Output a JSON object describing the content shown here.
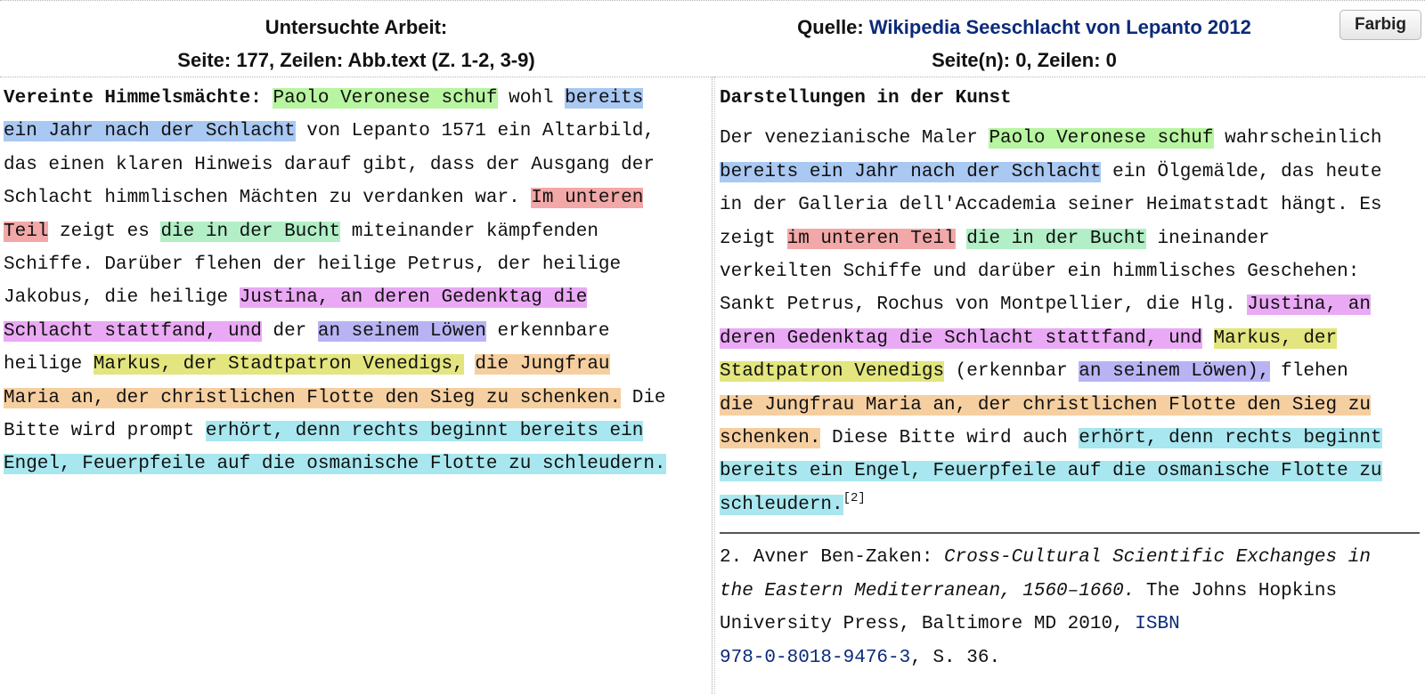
{
  "header": {
    "left": {
      "title": "Untersuchte Arbeit:",
      "subtitle": "Seite: 177, Zeilen: Abb.text (Z. 1-2, 3-9)"
    },
    "right": {
      "source_label": "Quelle: ",
      "source_link": "Wikipedia Seeschlacht von Lepanto 2012",
      "subtitle": "Seite(n): 0, Zeilen: 0"
    },
    "farbig_button": "Farbig"
  },
  "highlight_colors": {
    "green": "#b8f5a0",
    "blue": "#a9c8f2",
    "red": "#f2a8a8",
    "mint": "#b2efc6",
    "pink": "#eaa9f5",
    "violet": "#b8b4f4",
    "yellow": "#e3e57e",
    "orange": "#f6cfa0",
    "cyan": "#a8e7ef"
  },
  "left_text": {
    "l1": {
      "bold": "Vereinte Himmelsmächte:",
      "sp1": " ",
      "h1": "Paolo Veronese schuf",
      "t1": " wohl ",
      "h2": "bereits"
    },
    "l2": {
      "h1": "ein Jahr nach der Schlacht",
      "t1": " von Lepanto 1571 ein Altarbild,"
    },
    "l3": {
      "t1": "das einen klaren Hinweis darauf gibt, dass der Ausgang der"
    },
    "l4": {
      "t1": "Schlacht himmlischen Mächten zu verdanken war. ",
      "h1": "Im unteren"
    },
    "l5": {
      "h1": "Teil",
      "t1": " zeigt es ",
      "h2": "die in der Bucht",
      "t2": " miteinander kämpfenden"
    },
    "l6": {
      "t1": "Schiffe. Darüber flehen der heilige Petrus, der heilige"
    },
    "l7": {
      "t1": "Jakobus, die heilige ",
      "h1": "Justina, an deren Gedenktag die"
    },
    "l8": {
      "h1": "Schlacht stattfand, und",
      "t1": " der ",
      "h2": "an seinem Löwen",
      "t2": " erkennbare"
    },
    "l9": {
      "t1": "heilige ",
      "h1": "Markus, der Stadtpatron Venedigs,",
      "sp1": " ",
      "h2": "die Jungfrau"
    },
    "l10": {
      "h1": "Maria an, der christlichen Flotte den Sieg zu schenken.",
      "t1": " Die"
    },
    "l11": {
      "t1": "Bitte wird prompt ",
      "h1": "erhört, denn rechts beginnt bereits ein"
    },
    "l12": {
      "h1": "Engel, Feuerpfeile auf die osmanische Flotte zu schleudern."
    }
  },
  "right_text": {
    "title": "Darstellungen in der Kunst",
    "l1": {
      "t1": "Der venezianische Maler ",
      "h1": "Paolo Veronese schuf",
      "t2": " wahrscheinlich"
    },
    "l2": {
      "h1": "bereits ein Jahr nach der Schlacht",
      "t1": " ein Ölgemälde, das heute"
    },
    "l3": {
      "t1": "in der Galleria dell'Accademia seiner Heimatstadt hängt. Es"
    },
    "l4": {
      "t1": "zeigt ",
      "h1": "im unteren Teil",
      "sp1": " ",
      "h2": "die in der Bucht",
      "t2": " ineinander"
    },
    "l5": {
      "t1": "verkeilten Schiffe und darüber ein himmlisches Geschehen:"
    },
    "l6": {
      "t1": "Sankt Petrus, Rochus von Montpellier, die Hlg. ",
      "h1": "Justina, an"
    },
    "l7": {
      "h1": "deren Gedenktag die Schlacht stattfand, und",
      "sp1": " ",
      "h2": "Markus, der"
    },
    "l8": {
      "h1": "Stadtpatron Venedigs",
      "t1": " (erkennbar ",
      "h2": "an seinem Löwen),",
      "t2": " flehen"
    },
    "l9": {
      "h1": "die Jungfrau Maria an, der christlichen Flotte den Sieg zu"
    },
    "l10": {
      "h1": "schenken.",
      "t1": " Diese Bitte wird auch ",
      "h2": "erhört, denn rechts beginnt"
    },
    "l11": {
      "h1": "bereits ein Engel, Feuerpfeile auf die osmanische Flotte zu"
    },
    "l12": {
      "h1": "schleudern.",
      "sup": "[2]"
    }
  },
  "footnote": {
    "f1": {
      "t1": "2. Avner Ben-Zaken: ",
      "i1": "Cross-Cultural Scientific Exchanges in"
    },
    "f2": {
      "i1": "the Eastern Mediterranean, 1560–1660.",
      "t1": " The Johns Hopkins"
    },
    "f3": {
      "t1": "University Press, Baltimore MD 2010, ",
      "link": "ISBN"
    },
    "f4": {
      "link": "978-0-8018-9476-3",
      "t1": ", S. 36."
    }
  }
}
